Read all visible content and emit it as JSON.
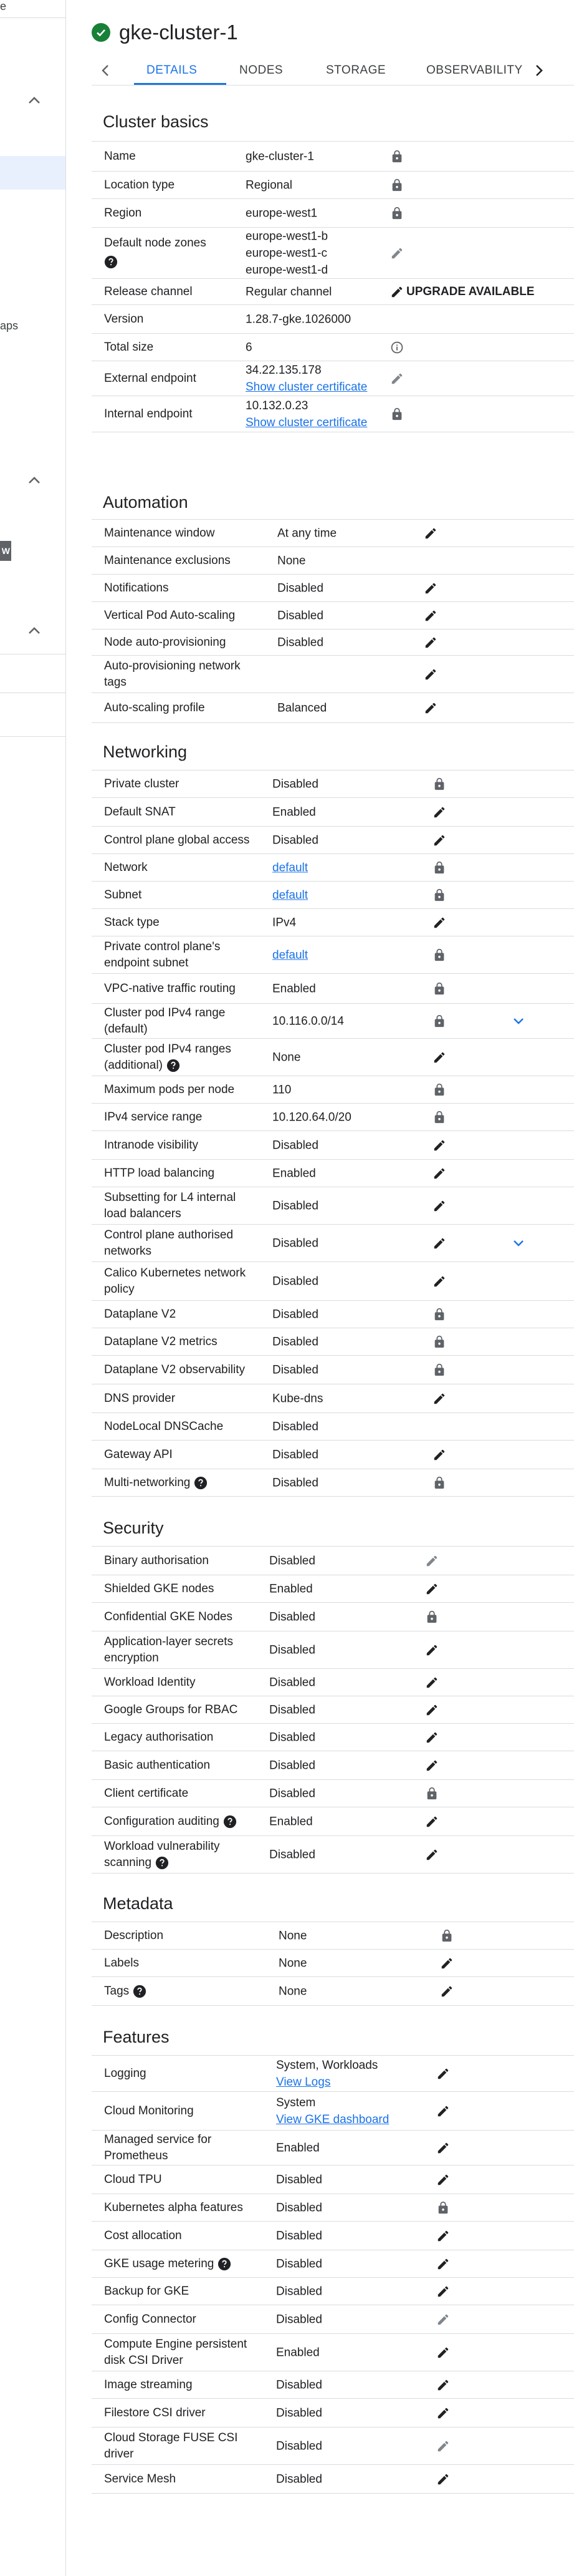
{
  "sidebar": {
    "partial_texts": [
      "e",
      "aps",
      "W"
    ]
  },
  "header": {
    "title": "gke-cluster-1",
    "status": "check-circle-icon"
  },
  "tabs": [
    "DETAILS",
    "NODES",
    "STORAGE",
    "OBSERVABILITY"
  ],
  "active_tab": "DETAILS",
  "cluster_basics": {
    "title": "Cluster basics",
    "upgrade_label": "UPGRADE AVAILABLE",
    "rows": [
      {
        "label": "Name",
        "value": "gke-cluster-1",
        "icon": "lock"
      },
      {
        "label": "Location type",
        "value": "Regional",
        "icon": "lock"
      },
      {
        "label": "Region",
        "value": "europe-west1",
        "icon": "lock"
      },
      {
        "label": "Default node zones",
        "values": [
          "europe-west1-b",
          "europe-west1-c",
          "europe-west1-d"
        ],
        "icon": "pencil-grey",
        "help": true
      },
      {
        "label": "Release channel",
        "value": "Regular channel",
        "icon": "pencil"
      },
      {
        "label": "Version",
        "value": "1.28.7-gke.1026000"
      },
      {
        "label": "Total size",
        "value": "6",
        "icon": "info"
      },
      {
        "label": "External endpoint",
        "value": "34.22.135.178",
        "link": "Show cluster certificate",
        "icon": "pencil-grey"
      },
      {
        "label": "Internal endpoint",
        "value": "10.132.0.23",
        "link": "Show cluster certificate",
        "icon": "lock"
      }
    ]
  },
  "automation": {
    "title": "Automation",
    "rows": [
      {
        "label": "Maintenance window",
        "value": "At any time",
        "icon": "pencil"
      },
      {
        "label": "Maintenance exclusions",
        "value": "None"
      },
      {
        "label": "Notifications",
        "value": "Disabled",
        "icon": "pencil"
      },
      {
        "label": "Vertical Pod Auto-scaling",
        "value": "Disabled",
        "icon": "pencil"
      },
      {
        "label": "Node auto-provisioning",
        "value": "Disabled",
        "icon": "pencil"
      },
      {
        "label": "Auto-provisioning network tags",
        "value": "",
        "icon": "pencil"
      },
      {
        "label": "Auto-scaling profile",
        "value": "Balanced",
        "icon": "pencil"
      }
    ]
  },
  "networking": {
    "title": "Networking",
    "rows": [
      {
        "label": "Private cluster",
        "value": "Disabled",
        "icon": "lock"
      },
      {
        "label": "Default SNAT",
        "value": "Enabled",
        "icon": "pencil"
      },
      {
        "label": "Control plane global access",
        "value": "Disabled",
        "icon": "pencil"
      },
      {
        "label": "Network",
        "value": "default",
        "is_link": true,
        "icon": "lock"
      },
      {
        "label": "Subnet",
        "value": "default",
        "is_link": true,
        "icon": "lock"
      },
      {
        "label": "Stack type",
        "value": "IPv4",
        "icon": "pencil"
      },
      {
        "label": "Private control plane's endpoint subnet",
        "value": "default",
        "is_link": true,
        "icon": "lock"
      },
      {
        "label": "VPC-native traffic routing",
        "value": "Enabled",
        "icon": "lock"
      },
      {
        "label": "Cluster pod IPv4 range (default)",
        "value": "10.116.0.0/14",
        "icon": "lock",
        "expand": true
      },
      {
        "label": "Cluster pod IPv4 ranges (additional)",
        "value": "None",
        "icon": "pencil",
        "help": true
      },
      {
        "label": "Maximum pods per node",
        "value": "110",
        "icon": "lock"
      },
      {
        "label": "IPv4 service range",
        "value": "10.120.64.0/20",
        "icon": "lock"
      },
      {
        "label": "Intranode visibility",
        "value": "Disabled",
        "icon": "pencil"
      },
      {
        "label": "HTTP load balancing",
        "value": "Enabled",
        "icon": "pencil"
      },
      {
        "label": "Subsetting for L4 internal load balancers",
        "value": "Disabled",
        "icon": "pencil"
      },
      {
        "label": "Control plane authorised networks",
        "value": "Disabled",
        "icon": "pencil",
        "expand": true
      },
      {
        "label": "Calico Kubernetes network policy",
        "value": "Disabled",
        "icon": "pencil"
      },
      {
        "label": "Dataplane V2",
        "value": "Disabled",
        "icon": "lock"
      },
      {
        "label": "Dataplane V2 metrics",
        "value": "Disabled",
        "icon": "lock"
      },
      {
        "label": "Dataplane V2 observability",
        "value": "Disabled",
        "icon": "lock"
      },
      {
        "label": "DNS provider",
        "value": "Kube-dns",
        "icon": "pencil"
      },
      {
        "label": "NodeLocal DNSCache",
        "value": "Disabled"
      },
      {
        "label": "Gateway API",
        "value": "Disabled",
        "icon": "pencil"
      },
      {
        "label": "Multi-networking",
        "value": "Disabled",
        "icon": "lock",
        "help": true
      }
    ]
  },
  "security": {
    "title": "Security",
    "rows": [
      {
        "label": "Binary authorisation",
        "value": "Disabled",
        "icon": "pencil-grey"
      },
      {
        "label": "Shielded GKE nodes",
        "value": "Enabled",
        "icon": "pencil"
      },
      {
        "label": "Confidential GKE Nodes",
        "value": "Disabled",
        "icon": "lock"
      },
      {
        "label": "Application-layer secrets encryption",
        "value": "Disabled",
        "icon": "pencil"
      },
      {
        "label": "Workload Identity",
        "value": "Disabled",
        "icon": "pencil"
      },
      {
        "label": "Google Groups for RBAC",
        "value": "Disabled",
        "icon": "pencil"
      },
      {
        "label": "Legacy authorisation",
        "value": "Disabled",
        "icon": "pencil"
      },
      {
        "label": "Basic authentication",
        "value": "Disabled",
        "icon": "pencil"
      },
      {
        "label": "Client certificate",
        "value": "Disabled",
        "icon": "lock"
      },
      {
        "label": "Configuration auditing",
        "value": "Enabled",
        "icon": "pencil",
        "help": true
      },
      {
        "label": "Workload vulnerability scanning",
        "value": "Disabled",
        "icon": "pencil",
        "help": true
      }
    ]
  },
  "metadata": {
    "title": "Metadata",
    "rows": [
      {
        "label": "Description",
        "value": "None",
        "icon": "lock"
      },
      {
        "label": "Labels",
        "value": "None",
        "icon": "pencil"
      },
      {
        "label": "Tags",
        "value": "None",
        "icon": "pencil",
        "help": true
      }
    ]
  },
  "features": {
    "title": "Features",
    "rows": [
      {
        "label": "Logging",
        "value": "System, Workloads",
        "link": "View Logs",
        "icon": "pencil"
      },
      {
        "label": "Cloud Monitoring",
        "value": "System",
        "link": "View GKE dashboard",
        "icon": "pencil"
      },
      {
        "label": "Managed service for Prometheus",
        "value": "Enabled",
        "icon": "pencil"
      },
      {
        "label": "Cloud TPU",
        "value": "Disabled",
        "icon": "pencil"
      },
      {
        "label": "Kubernetes alpha features",
        "value": "Disabled",
        "icon": "lock"
      },
      {
        "label": "Cost allocation",
        "value": "Disabled",
        "icon": "pencil"
      },
      {
        "label": "GKE usage metering",
        "value": "Disabled",
        "icon": "pencil",
        "help": true
      },
      {
        "label": "Backup for GKE",
        "value": "Disabled",
        "icon": "pencil"
      },
      {
        "label": "Config Connector",
        "value": "Disabled",
        "icon": "pencil-grey"
      },
      {
        "label": "Compute Engine persistent disk CSI Driver",
        "value": "Enabled",
        "icon": "pencil"
      },
      {
        "label": "Image streaming",
        "value": "Disabled",
        "icon": "pencil"
      },
      {
        "label": "Filestore CSI driver",
        "value": "Disabled",
        "icon": "pencil"
      },
      {
        "label": "Cloud Storage FUSE CSI driver",
        "value": "Disabled",
        "icon": "pencil-grey"
      },
      {
        "label": "Service Mesh",
        "value": "Disabled",
        "icon": "pencil"
      }
    ]
  }
}
